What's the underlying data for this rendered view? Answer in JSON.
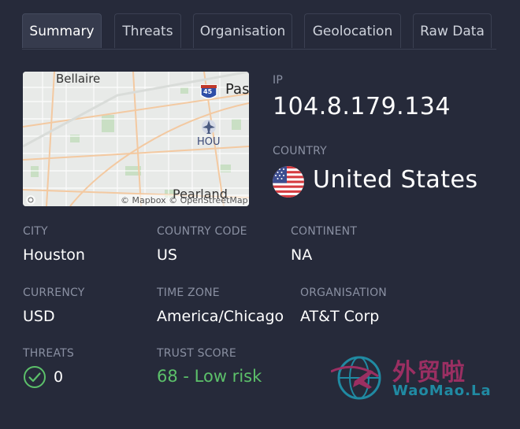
{
  "tabs": [
    {
      "label": "Summary",
      "active": true
    },
    {
      "label": "Threats"
    },
    {
      "label": "Organisation"
    },
    {
      "label": "Geolocation"
    },
    {
      "label": "Raw Data"
    }
  ],
  "map": {
    "labels": {
      "bellaire": "Bellaire",
      "pasadena": "Pas",
      "hou": "HOU",
      "pearland": "Pearland",
      "interstate": "45"
    },
    "attribution": "© Mapbox © OpenStreetMap"
  },
  "ip": {
    "label": "IP",
    "value": "104.8.179.134"
  },
  "country": {
    "label": "COUNTRY",
    "value": "United States",
    "flag_icon": "us-flag-icon"
  },
  "fields": {
    "city": {
      "label": "CITY",
      "value": "Houston"
    },
    "country_code": {
      "label": "COUNTRY CODE",
      "value": "US"
    },
    "continent": {
      "label": "CONTINENT",
      "value": "NA"
    },
    "currency": {
      "label": "CURRENCY",
      "value": "USD"
    },
    "time_zone": {
      "label": "TIME ZONE",
      "value": "America/Chicago"
    },
    "organisation": {
      "label": "ORGANISATION",
      "value": "AT&T Corp"
    },
    "threats": {
      "label": "THREATS",
      "value": "0"
    },
    "trust_score": {
      "label": "TRUST SCORE",
      "value": "68 - Low risk"
    }
  },
  "watermark": {
    "cn": "外贸啦",
    "en": "WaoMao.La"
  },
  "colors": {
    "background": "#262a3a",
    "tab_active": "#363b4d",
    "label": "#8a90a2",
    "success": "#5cc06a",
    "watermark": "#b0306a"
  }
}
